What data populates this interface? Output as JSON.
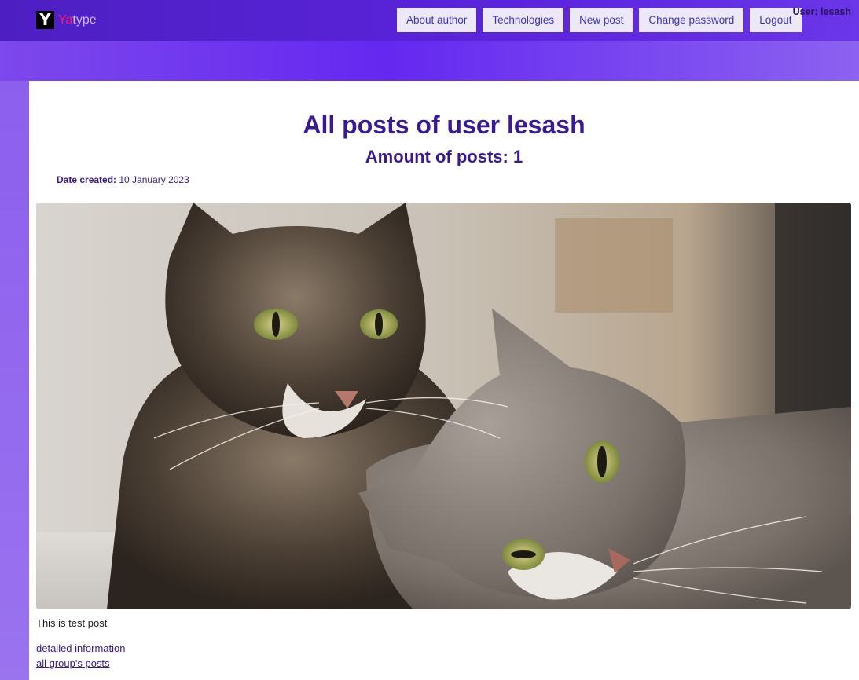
{
  "brand": {
    "logo_letter": "Y",
    "name_prefix": "Ya",
    "name_suffix": "type"
  },
  "nav": {
    "items": [
      {
        "label": "About author"
      },
      {
        "label": "Technologies"
      },
      {
        "label": "New post"
      },
      {
        "label": "Change password"
      },
      {
        "label": "Logout"
      }
    ],
    "user_label": "User: lesash"
  },
  "page": {
    "title": "All posts of user lesash",
    "subtitle": "Amount of posts: 1"
  },
  "post": {
    "date_label": "Date created:",
    "date_value": "10 January 2023",
    "image_icon": "cat-photo",
    "text": "This is test post",
    "link_details": "detailed information",
    "link_group": "all group's posts"
  },
  "colors": {
    "header": "#4d1fc2",
    "accent_text": "#3a1a94",
    "brand_ya": "#ff1a6d",
    "nav_button_bg": "#ece8f5"
  }
}
